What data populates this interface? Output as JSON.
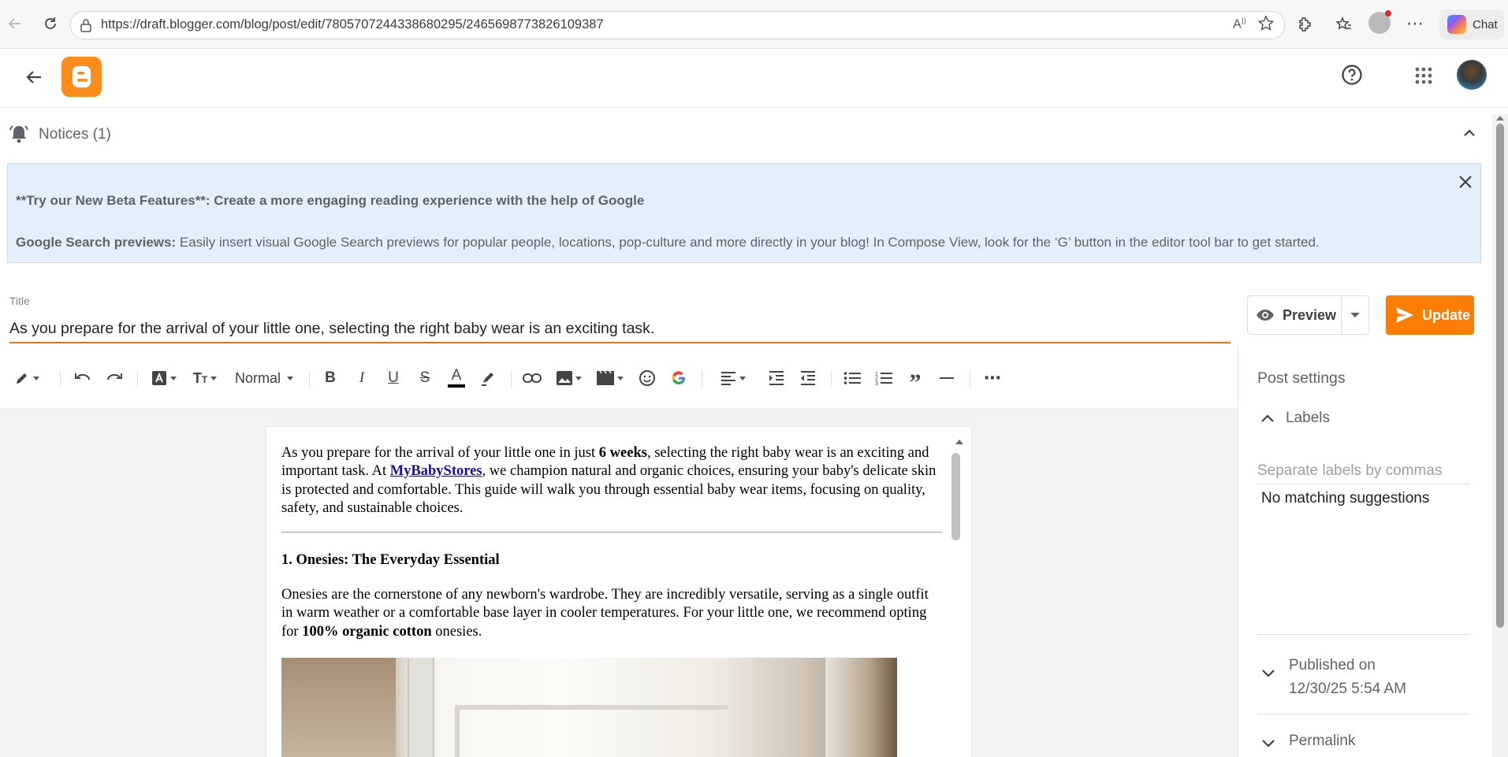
{
  "browser": {
    "url": "https://draft.blogger.com/blog/post/edit/7805707244338680295/2465698773826109387",
    "chat_label": "Chat"
  },
  "notices": {
    "title": "Notices (1)",
    "line1": "**Try our New Beta Features**: Create a more engaging reading experience with the help of Google",
    "line2_bold": "Google Search previews:",
    "line2_rest": " Easily insert visual Google Search previews for popular people, locations, pop-culture and more directly in your blog! In Compose View, look for the ‘G’ button in the editor tool bar to get started."
  },
  "post": {
    "title_label": "Title",
    "title_value": "As you prepare for the arrival of your little one, selecting the right baby wear is an exciting task."
  },
  "actions": {
    "preview_label": "Preview",
    "update_label": "Update",
    "accent": "#fc7d05"
  },
  "toolbar": {
    "paragraph_style": "Normal"
  },
  "content": {
    "p1_a": "As you prepare for the arrival of your little one in just ",
    "p1_b": "6 weeks",
    "p1_c": ", selecting the right baby wear is an exciting and important task. At ",
    "p1_link": "MyBabyStores",
    "p1_d": ", we champion natural and organic choices, ensuring your baby's delicate skin is protected and comfortable. This guide will walk you through essential baby wear items, focusing on quality, safety, and sustainable choices.",
    "h1": "1. Onesies: The Everyday Essential",
    "p2_a": "Onesies are the cornerstone of any newborn's wardrobe. They are incredibly versatile, serving as a single outfit in warm weather or a comfortable base layer in cooler temperatures. For your little one, we recommend opting for ",
    "p2_b": "100% organic cotton",
    "p2_c": " onesies."
  },
  "sidebar": {
    "post_settings": "Post settings",
    "labels_title": "Labels",
    "labels_placeholder": "Separate labels by commas",
    "no_match": "No matching suggestions",
    "published_title": "Published on",
    "published_date": "12/30/25 5:54 AM",
    "permalink_title": "Permalink"
  },
  "icons": {
    "back": "arrow-left-icon",
    "reload": "reload-icon",
    "help": "help-circle-icon",
    "apps": "apps-grid-icon",
    "bell": "bell-icon"
  }
}
